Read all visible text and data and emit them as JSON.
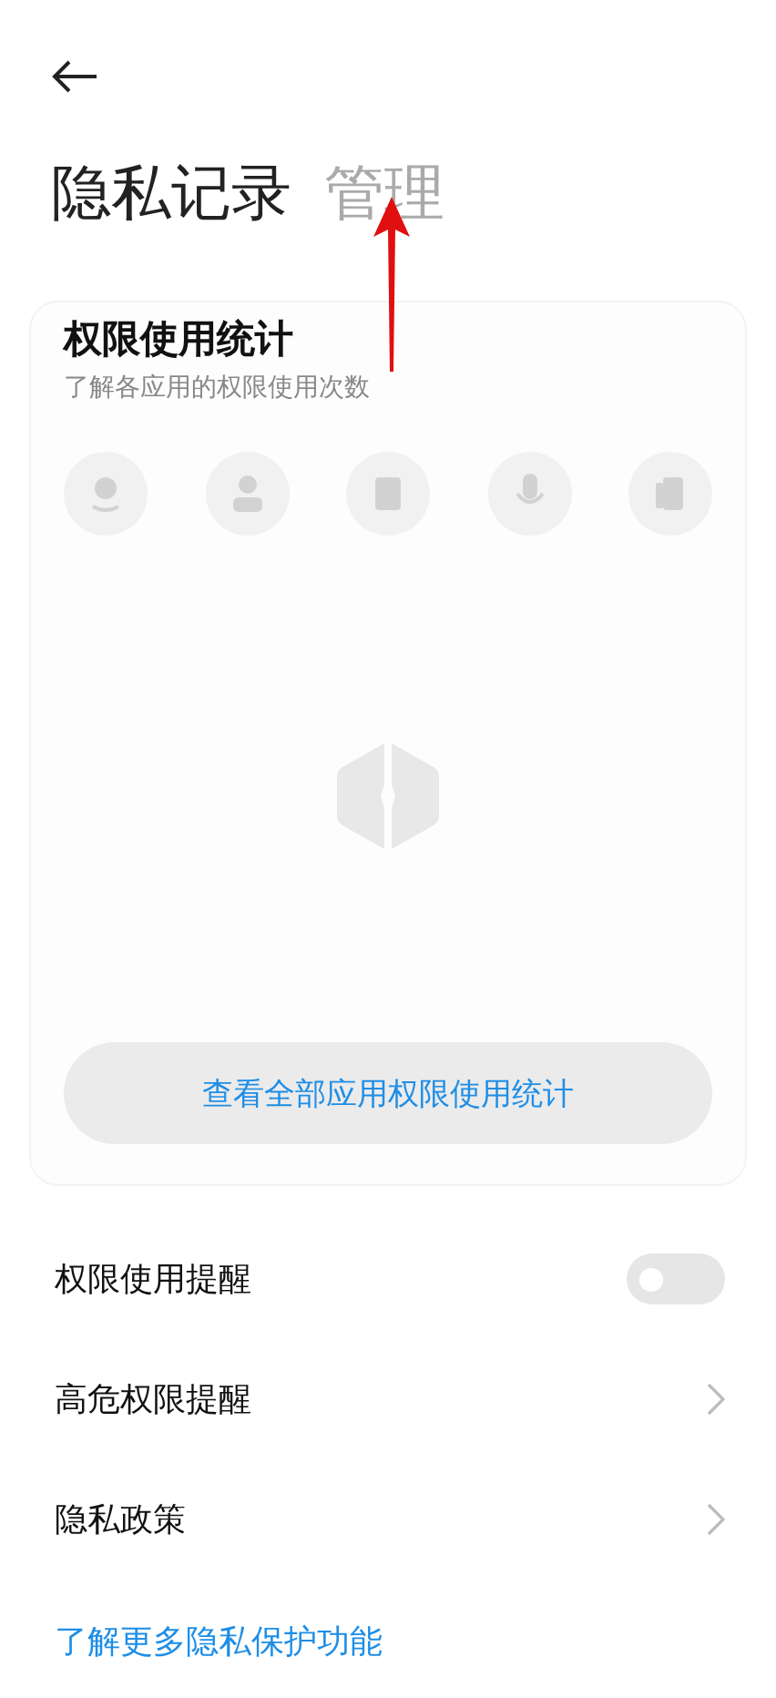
{
  "tabs": [
    {
      "label": "隐私记录",
      "selected": true
    },
    {
      "label": "管理",
      "selected": false
    }
  ],
  "card": {
    "title": "权限使用统计",
    "subtitle": "了解各应用的权限使用次数",
    "button": "查看全部应用权限使用统计"
  },
  "settings": [
    {
      "kind": "toggle",
      "label": "权限使用提醒",
      "on": false
    },
    {
      "kind": "link",
      "label": "高危权限提醒"
    },
    {
      "kind": "link",
      "label": "隐私政策"
    }
  ],
  "footer_link": "了解更多隐私保护功能"
}
